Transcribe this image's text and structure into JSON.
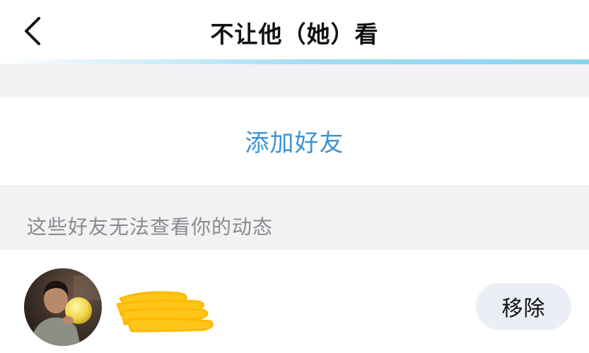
{
  "header": {
    "back_icon": "chevron-left-icon",
    "title": "不让他（她）看"
  },
  "add_friend": {
    "label": "添加好友",
    "color": "#3d93d6"
  },
  "section": {
    "description": "这些好友无法查看你的动态"
  },
  "friends": [
    {
      "avatar_icon": "user-avatar",
      "name_redacted": true,
      "redaction_color": "#ffc619",
      "action_label": "移除"
    }
  ],
  "colors": {
    "accent_line": "#86d4f2",
    "background_gray": "#f2f2f4",
    "remove_button_bg": "#eceef6"
  }
}
